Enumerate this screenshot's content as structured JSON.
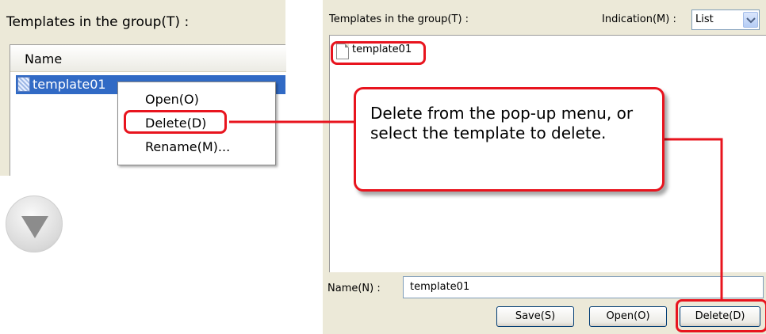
{
  "left_panel": {
    "header": "Templates in the group(T) :",
    "column_header": "Name",
    "selected_item": "template01",
    "context_menu": {
      "open": "Open(O)",
      "delete": "Delete(D)",
      "rename": "Rename(M)..."
    }
  },
  "right_window": {
    "header": "Templates in the group(T) :",
    "indication_label": "Indication(M) :",
    "indication_value": "List",
    "list_item": "template01",
    "name_label": "Name(N) :",
    "name_value": "template01",
    "buttons": {
      "save": "Save(S)",
      "open": "Open(O)",
      "delete": "Delete(D)"
    }
  },
  "callout": {
    "text": "Delete from the pop-up menu, or select the template to delete."
  },
  "icons": [
    "template-file-icon",
    "chevron-down-icon",
    "down-arrow-icon"
  ],
  "colors": {
    "highlight": "#e8141e",
    "selection": "#316ac5",
    "panel_background": "#ece9d8"
  }
}
